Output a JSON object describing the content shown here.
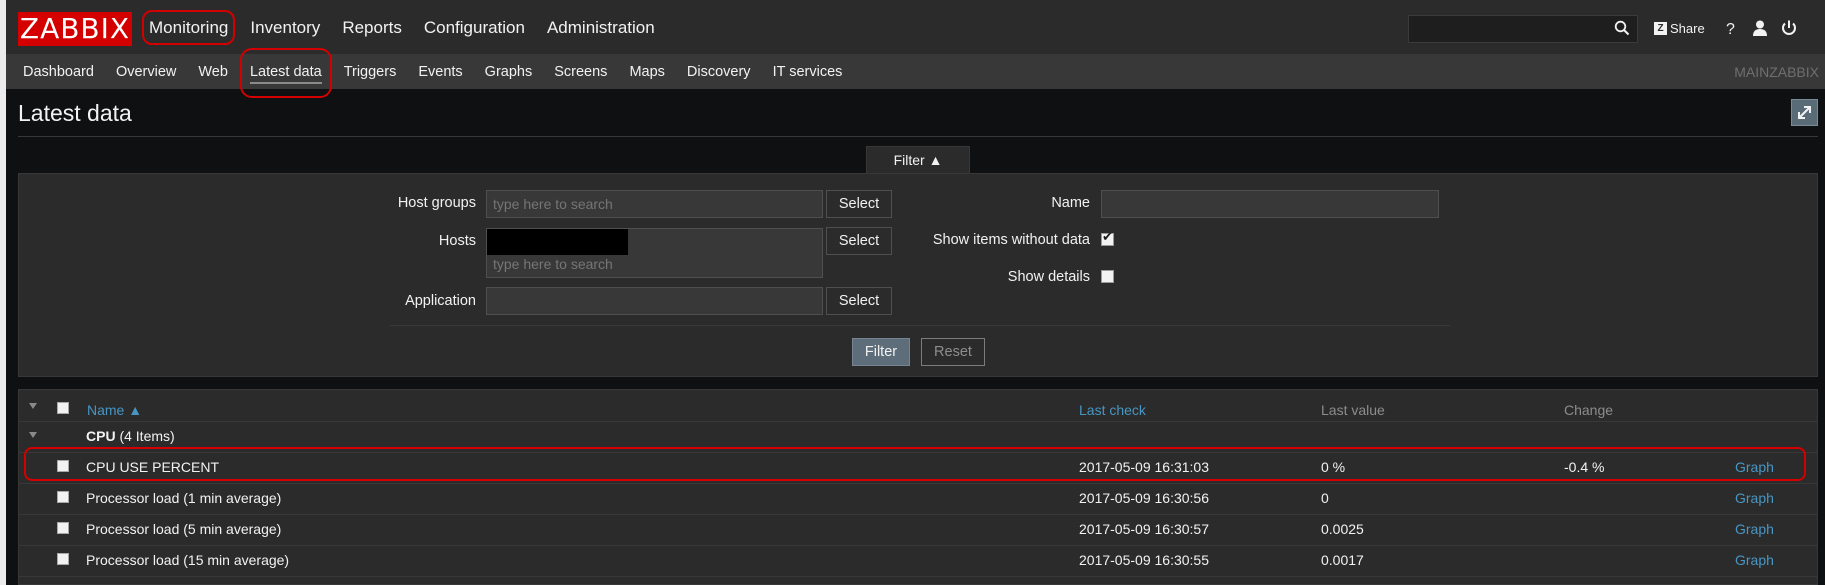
{
  "header": {
    "logo": "ZABBIX",
    "menu": [
      "Monitoring",
      "Inventory",
      "Reports",
      "Configuration",
      "Administration"
    ],
    "search_placeholder": "",
    "share_label": "Share",
    "icons": [
      "search-icon",
      "help-icon",
      "user-icon",
      "power-icon"
    ]
  },
  "subnav": {
    "items": [
      "Dashboard",
      "Overview",
      "Web",
      "Latest data",
      "Triggers",
      "Events",
      "Graphs",
      "Screens",
      "Maps",
      "Discovery",
      "IT services"
    ],
    "selected": "Latest data",
    "server_name": "MAINZABBIX"
  },
  "page": {
    "title": "Latest data"
  },
  "filter": {
    "tab_label": "Filter ▲",
    "host_groups_label": "Host groups",
    "host_groups_placeholder": "type here to search",
    "hosts_label": "Hosts",
    "hosts_placeholder": "type here to search",
    "application_label": "Application",
    "application_value": "",
    "select_label": "Select",
    "name_label": "Name",
    "name_value": "",
    "show_items_without_data_label": "Show items without data",
    "show_items_without_data": true,
    "show_details_label": "Show details",
    "show_details": false,
    "filter_button": "Filter",
    "reset_button": "Reset"
  },
  "table": {
    "columns": {
      "name": "Name ▲",
      "last_check": "Last check",
      "last_value": "Last value",
      "change": "Change"
    },
    "group": {
      "name": "CPU",
      "count": "(4 Items)"
    },
    "rows": [
      {
        "name": "CPU USE PERCENT",
        "last_check": "2017-05-09 16:31:03",
        "last_value": "0 %",
        "change": "-0.4 %",
        "action": "Graph"
      },
      {
        "name": "Processor load (1 min average)",
        "last_check": "2017-05-09 16:30:56",
        "last_value": "0",
        "change": "",
        "action": "Graph"
      },
      {
        "name": "Processor load (5 min average)",
        "last_check": "2017-05-09 16:30:57",
        "last_value": "0.0025",
        "change": "",
        "action": "Graph"
      },
      {
        "name": "Processor load (15 min average)",
        "last_check": "2017-05-09 16:30:55",
        "last_value": "0.0017",
        "change": "",
        "action": "Graph"
      }
    ]
  },
  "colors": {
    "brand_red": "#d40000",
    "link_blue": "#4796c4",
    "panel_bg": "#2b2b2b"
  }
}
